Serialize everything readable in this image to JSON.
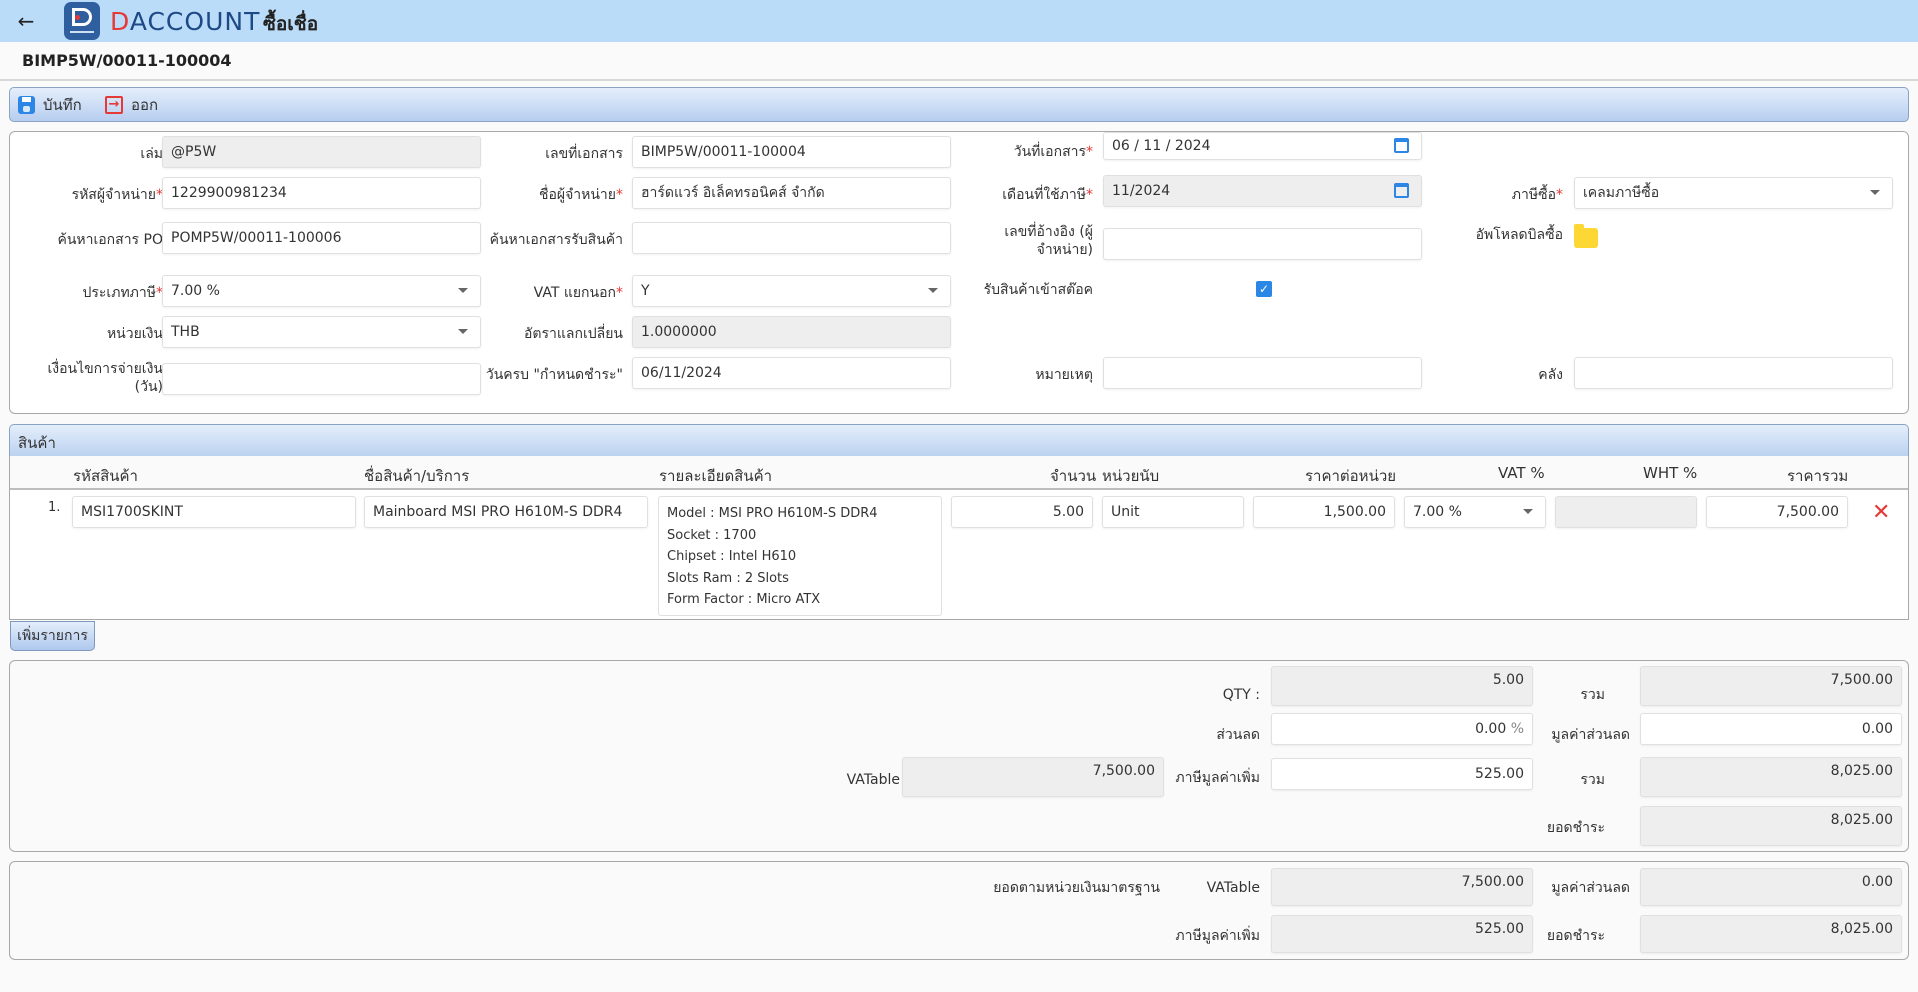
{
  "header": {
    "back_icon": "arrow-left-icon",
    "brand_first": "D",
    "brand_rest": "ACCOUNT",
    "title": "ซื้อเชื่อ"
  },
  "doc": {
    "number": "BIMP5W/00011-100004"
  },
  "toolbar": {
    "save_label": "บันทึก",
    "save_icon": "save-icon",
    "exit_label": "ออก",
    "exit_icon": "exit-icon"
  },
  "form": {
    "book": {
      "label": "เล่ม",
      "value": "@P5W"
    },
    "doc_no": {
      "label": "เลขที่เอกสาร",
      "value": "BIMP5W/00011-100004"
    },
    "doc_date": {
      "label": "วันที่เอกสาร",
      "value": "06 / 11 /  2024"
    },
    "vendor_code": {
      "label": "รหัสผู้จำหน่าย",
      "value": "1229900981234"
    },
    "vendor_name": {
      "label": "ชื่อผู้จำหน่าย",
      "value": "ฮาร์ดแวร์ อิเล็คทรอนิคส์ จำกัด"
    },
    "tax_month": {
      "label": "เดือนที่ใช้ภาษี",
      "value": "11/2024"
    },
    "purchase_tax": {
      "label": "ภาษีซื้อ",
      "value": "เคลมภาษีซื้อ"
    },
    "po_search": {
      "label": "ค้นหาเอกสาร PO",
      "value": "POMP5W/00011-100006"
    },
    "receipt_search": {
      "label": "ค้นหาเอกสารรับสินค้า",
      "value": ""
    },
    "vendor_ref": {
      "label_line1": "เลขที่อ้างอิง (ผู้",
      "label_line2": "จำหน่าย)",
      "value": ""
    },
    "upload": {
      "label": "อัพโหลดบิลซื้อ",
      "icon": "folder-icon"
    },
    "tax_type": {
      "label": "ประเภทภาษี",
      "value": "7.00 %"
    },
    "vat_separate": {
      "label": "VAT แยกนอก",
      "value": "Y"
    },
    "receive_stock": {
      "label": "รับสินค้าเข้าสต๊อค",
      "checked": true,
      "check_glyph": "✓"
    },
    "currency": {
      "label": "หน่วยเงิน",
      "value": "THB"
    },
    "exchange_rate": {
      "label": "อัตราแลกเปลี่ยน",
      "value": "1.0000000"
    },
    "payment_terms": {
      "label_line1": "เงื่อนไขการจ่ายเงิน",
      "label_line2": "(วัน)",
      "value": ""
    },
    "due_date": {
      "label": "วันครบ \"กำหนดชำระ\"",
      "value": "06/11/2024"
    },
    "remark": {
      "label": "หมายเหตุ",
      "value": ""
    },
    "warehouse": {
      "label": "คลัง",
      "value": ""
    }
  },
  "products": {
    "section_title": "สินค้า",
    "columns": [
      "รหัสสินค้า",
      "ชื่อสินค้า/บริการ",
      "รายละเอียดสินค้า",
      "จำนวน",
      "หน่วยนับ",
      "ราคาต่อหน่วย",
      "VAT %",
      "WHT %",
      "ราคารวม"
    ],
    "rows": [
      {
        "no": "1.",
        "code": "MSI1700SKINT",
        "name": "Mainboard MSI PRO H610M-S DDR4",
        "details": [
          "Model : MSI PRO H610M-S DDR4",
          "Socket : 1700",
          "Chipset : Intel H610",
          "Slots Ram : 2 Slots",
          "Form Factor : Micro ATX"
        ],
        "qty": "5.00",
        "unit": "Unit",
        "unit_price": "1,500.00",
        "vat": "7.00 %",
        "wht": "",
        "total": "7,500.00",
        "delete_glyph": "✕"
      }
    ],
    "add_label": "เพิ่มรายการ"
  },
  "summary": {
    "qty": {
      "label": "QTY :",
      "value": "5.00"
    },
    "subtotal": {
      "label": "รวม",
      "value": "7,500.00"
    },
    "discount_pct": {
      "label": "ส่วนลด",
      "value": "0.00",
      "suffix": "%"
    },
    "discount_value": {
      "label": "มูลค่าส่วนลด",
      "value": "0.00"
    },
    "vatable": {
      "label": "VATable",
      "value": "7,500.00"
    },
    "vat": {
      "label": "ภาษีมูลค่าเพิ่ม",
      "value": "525.00"
    },
    "total": {
      "label": "รวม",
      "value": "8,025.00"
    },
    "grand_total": {
      "label": "ยอดชำระ",
      "value": "8,025.00"
    }
  },
  "base_currency": {
    "title": "ยอดตามหน่วยเงินมาตรฐาน",
    "vatable": {
      "label": "VATable",
      "value": "7,500.00"
    },
    "discount_value": {
      "label": "มูลค่าส่วนลด",
      "value": "0.00"
    },
    "vat": {
      "label": "ภาษีมูลค่าเพิ่ม",
      "value": "525.00"
    },
    "grand_total": {
      "label": "ยอดชำระ",
      "value": "8,025.00"
    }
  },
  "colors": {
    "topbar": "#bbdcf8",
    "accent_blue": "#2b86e6",
    "required_red": "#e53935",
    "folder_yellow": "#fdd835"
  }
}
